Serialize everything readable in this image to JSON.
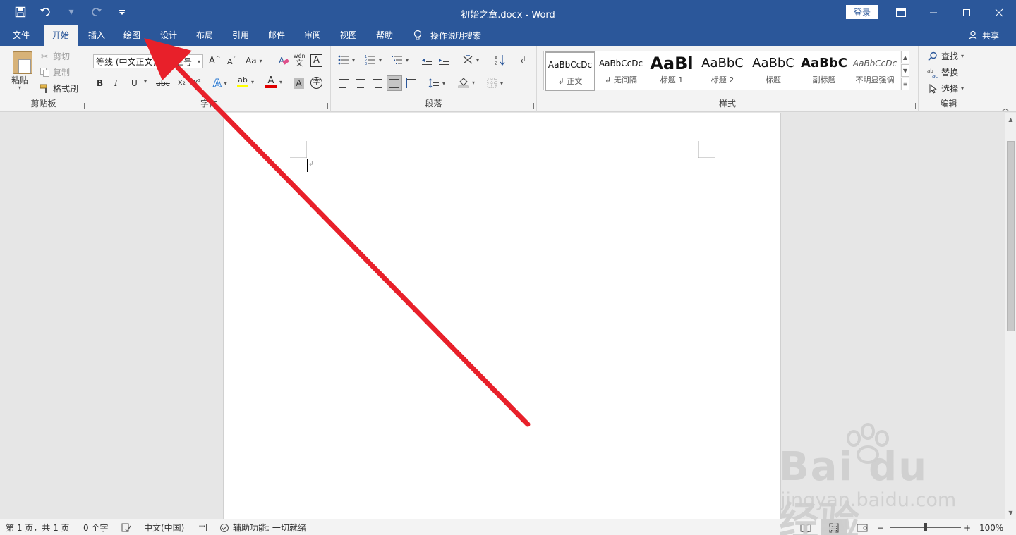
{
  "titlebar": {
    "doc_title": "初始之章.docx  -  Word",
    "login": "登录",
    "qat": {
      "save_icon": "save-icon",
      "undo_icon": "undo-icon",
      "redo_icon": "redo-icon",
      "customize_icon": "customize-qat-icon"
    }
  },
  "tabs": [
    {
      "label": "文件"
    },
    {
      "label": "开始"
    },
    {
      "label": "插入"
    },
    {
      "label": "绘图"
    },
    {
      "label": "设计"
    },
    {
      "label": "布局"
    },
    {
      "label": "引用"
    },
    {
      "label": "邮件"
    },
    {
      "label": "审阅"
    },
    {
      "label": "视图"
    },
    {
      "label": "帮助"
    }
  ],
  "tellme": "操作说明搜索",
  "share": "共享",
  "clipboard": {
    "paste": "粘贴",
    "cut": "剪切",
    "copy": "复制",
    "format_painter": "格式刷",
    "label": "剪贴板"
  },
  "font": {
    "name": "等线 (中文正文)",
    "size": "五号",
    "label": "字体",
    "bold": "B",
    "italic": "I",
    "underline": "U",
    "strike": "abc",
    "case": "Aa",
    "phonetic": "wén",
    "border_char": "A",
    "shade_char": "A",
    "enclose": "字",
    "grow": "A",
    "shrink": "A",
    "effects": "A",
    "highlight": "ab",
    "color": "A",
    "sub": "x₂",
    "sup": "x²"
  },
  "paragraph": {
    "label": "段落"
  },
  "styles": {
    "label": "样式",
    "items": [
      {
        "sample": "AaBbCcDc",
        "name": "↲ 正文"
      },
      {
        "sample": "AaBbCcDc",
        "name": "↲ 无间隔"
      },
      {
        "sample": "AaBl",
        "name": "标题 1"
      },
      {
        "sample": "AaBbC",
        "name": "标题 2"
      },
      {
        "sample": "AaBbC",
        "name": "标题"
      },
      {
        "sample": "AaBbC",
        "name": "副标题"
      },
      {
        "sample": "AaBbCcDc",
        "name": "不明显强调"
      }
    ]
  },
  "editing": {
    "find": "查找",
    "replace": "替换",
    "select": "选择",
    "label": "编辑"
  },
  "status": {
    "page": "第 1 页，共 1 页",
    "words": "0 个字",
    "language": "中文(中国)",
    "accessibility": "辅助功能: 一切就绪",
    "zoom": "100%",
    "zoom_minus": "−",
    "zoom_plus": "+"
  },
  "watermark": {
    "main": "Bai du 经验",
    "sub": "jingyan.baidu.com"
  },
  "colors": {
    "brand": "#2b579a",
    "arrow": "#e8202a",
    "font_color_bar": "#e00000",
    "highlight_bar": "#ffff00"
  }
}
